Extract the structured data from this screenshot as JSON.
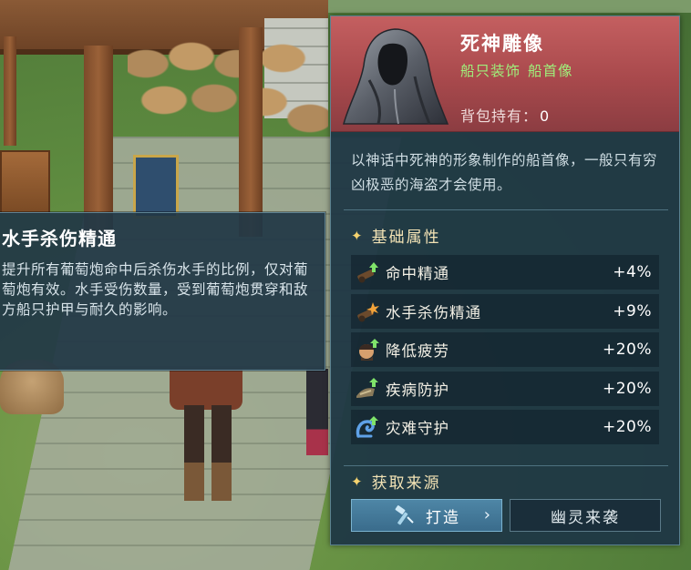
{
  "skill_tooltip": {
    "title": "水手杀伤精通",
    "description": "提升所有葡萄炮命中后杀伤水手的比例，仅对葡萄炮有效。水手受伤数量，受到葡萄炮贯穿和敌方船只护甲与耐久的影响。"
  },
  "item": {
    "name": "死神雕像",
    "tags": [
      "船只装饰",
      "船首像"
    ],
    "owned_label": "背包持有：",
    "owned_count": "0",
    "description": "以神话中死神的形象制作的船首像，一般只有穷凶极恶的海盗才会使用。",
    "rarity_color": "#b24d50",
    "image_icon": "hooded-reaper-statue-icon"
  },
  "base_attributes": {
    "title": "基础属性",
    "items": [
      {
        "name": "命中精通",
        "value": "+4%",
        "icon": "cannon-upgrade-icon"
      },
      {
        "name": "水手杀伤精通",
        "value": "+9%",
        "icon": "cannon-blast-icon"
      },
      {
        "name": "降低疲劳",
        "value": "+20%",
        "icon": "sailor-rest-icon"
      },
      {
        "name": "疾病防护",
        "value": "+20%",
        "icon": "bandage-upgrade-icon"
      },
      {
        "name": "灾难守护",
        "value": "+20%",
        "icon": "wave-guard-icon"
      }
    ]
  },
  "source": {
    "title": "获取来源",
    "craft_label": "打造",
    "ghost_label": "幽灵来袭"
  }
}
